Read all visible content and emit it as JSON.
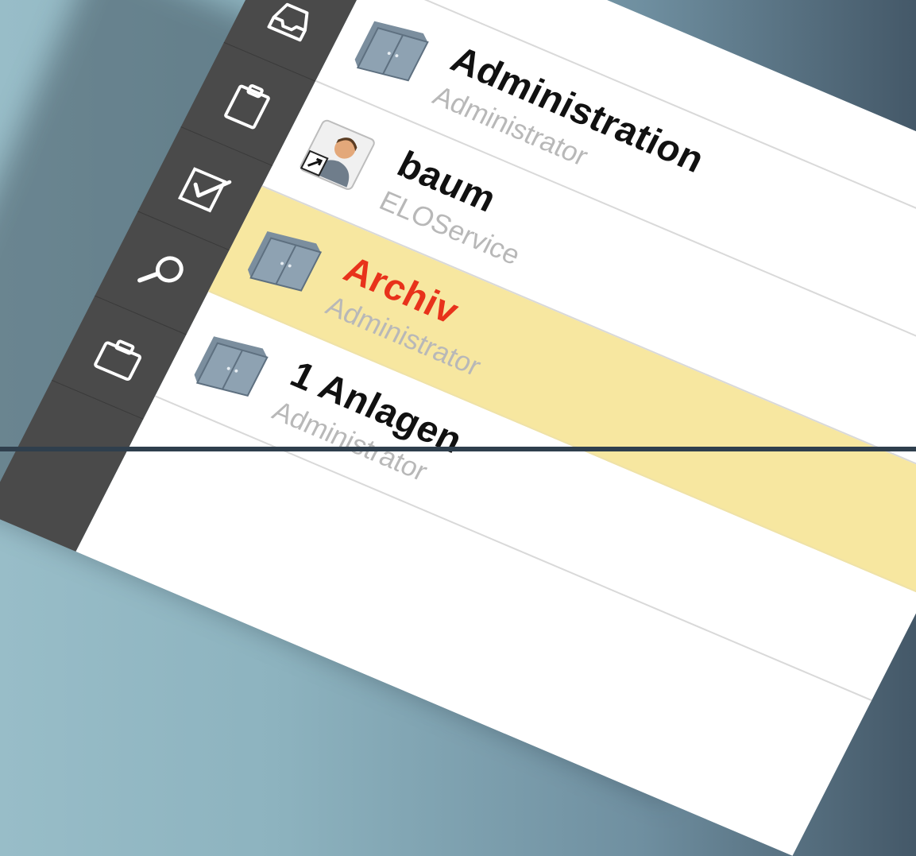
{
  "sidebar": {
    "buttons": [
      {
        "name": "window-icon"
      },
      {
        "name": "inbox-tray-icon"
      },
      {
        "name": "clipboard-icon"
      },
      {
        "name": "checkbox-icon"
      },
      {
        "name": "search-icon"
      },
      {
        "name": "briefcase-icon"
      }
    ]
  },
  "list": {
    "items": [
      {
        "title": "Administration",
        "subtitle": "Administrator",
        "icon": "cabinet-icon",
        "selected": false
      },
      {
        "title": "baum",
        "subtitle": "ELOService",
        "icon": "user-shortcut-icon",
        "selected": false
      },
      {
        "title": "Archiv",
        "subtitle": "Administrator",
        "icon": "cabinet-icon",
        "selected": true
      },
      {
        "title": "1 Anlagen",
        "subtitle": "Administrator",
        "icon": "cabinet-icon",
        "selected": false
      }
    ]
  },
  "colors": {
    "selected_background": "#f7e7a0",
    "selected_title": "#e8321b",
    "sidebar": "#4a4a4a",
    "background": "#98bdc8"
  }
}
